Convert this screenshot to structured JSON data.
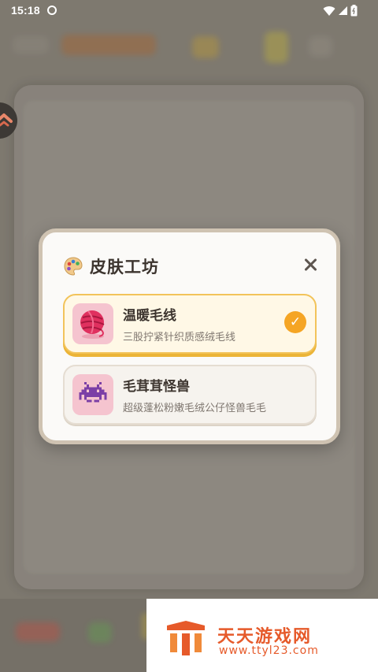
{
  "status_bar": {
    "time": "15:18"
  },
  "dialog": {
    "title": "皮肤工坊",
    "skins": [
      {
        "name": "温暖毛线",
        "description": "三股拧紧针织质感绒毛线",
        "selected": true,
        "icon": "yarn-ball-icon"
      },
      {
        "name": "毛茸茸怪兽",
        "description": "超级蓬松粉嫩毛绒公仔怪兽毛毛",
        "selected": false,
        "icon": "pixel-monster-icon"
      }
    ],
    "check_mark": "✓"
  },
  "watermark": {
    "title": "天天游戏网",
    "url": "www.ttyl23.com"
  },
  "colors": {
    "accent": "#f5a524",
    "selected_border": "#f2c35a",
    "thumb_bg": "#f5c4cf",
    "watermark": "#e65a2a"
  }
}
